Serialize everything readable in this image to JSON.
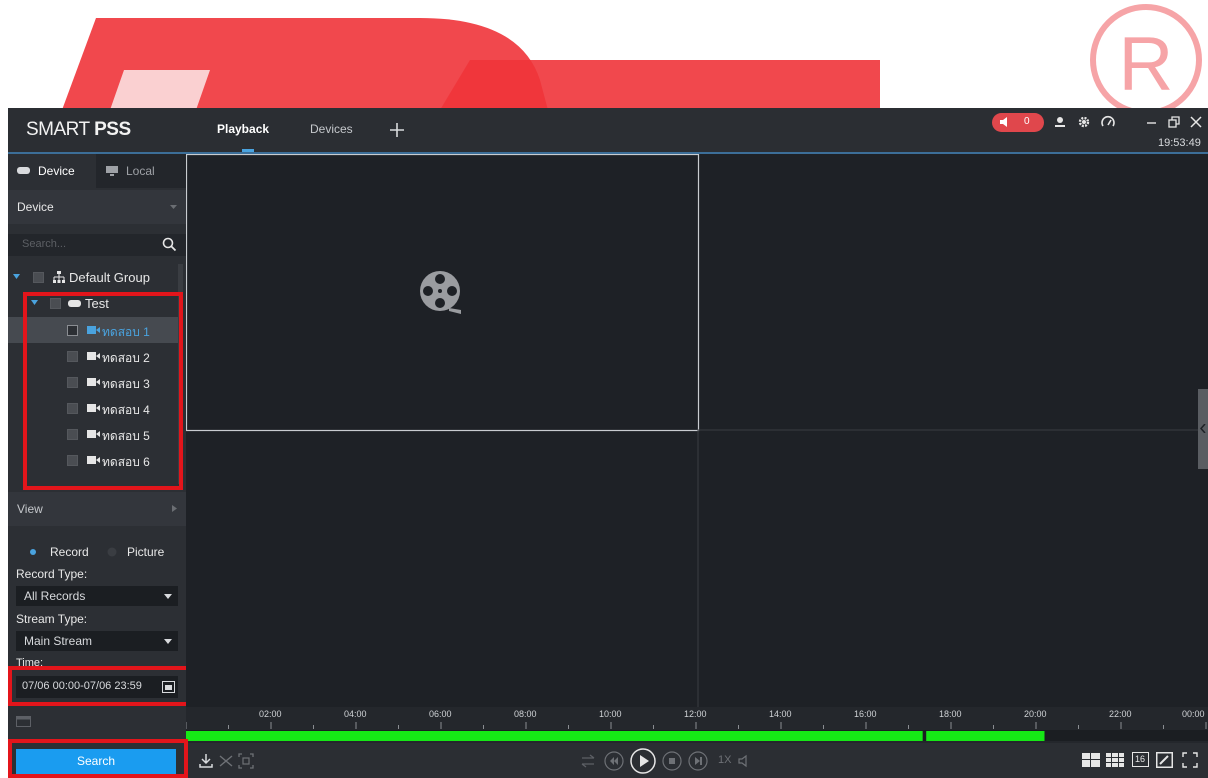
{
  "app": {
    "brand_light": "SMART ",
    "brand_bold": "PSS",
    "tabs": [
      {
        "label": "Playback",
        "active": true
      },
      {
        "label": "Devices",
        "active": false
      }
    ],
    "add_tab_icon": "plus-icon",
    "alarm_count": "0",
    "clock": "19:53:49",
    "accent_color": "#1a9cf0",
    "alarm_color": "#e0474c",
    "recording_color": "#16e816"
  },
  "sidebar": {
    "tabs": [
      {
        "label": "Device",
        "icon": "device-icon",
        "active": true
      },
      {
        "label": "Local",
        "icon": "monitor-icon",
        "active": false
      }
    ],
    "device_section": "Device",
    "search_placeholder": "Search...",
    "tree": {
      "group": "Default Group",
      "device": "Test",
      "channels": [
        "ทดสอบ 1",
        "ทดสอบ 2",
        "ทดสอบ 3",
        "ทดสอบ 4",
        "ทดสอบ 5",
        "ทดสอบ 6"
      ]
    },
    "view_section": "View",
    "mode_options": [
      "Record",
      "Picture"
    ],
    "record_type_label": "Record Type:",
    "record_type_value": "All Records",
    "stream_type_label": "Stream Type:",
    "stream_type_value": "Main Stream",
    "time_label": "Time:",
    "time_value": "07/06 00:00-07/06 23:59",
    "search_button": "Search"
  },
  "timeline": {
    "labels": [
      "02:00",
      "04:00",
      "06:00",
      "08:00",
      "10:00",
      "12:00",
      "14:00",
      "16:00",
      "18:00",
      "20:00",
      "22:00",
      "00:00"
    ],
    "recordings": [
      {
        "from": "00:00",
        "to": "17:20"
      },
      {
        "from": "17:25",
        "to": "20:12"
      }
    ]
  },
  "controls": {
    "speed": "1X",
    "split_16": "16"
  }
}
